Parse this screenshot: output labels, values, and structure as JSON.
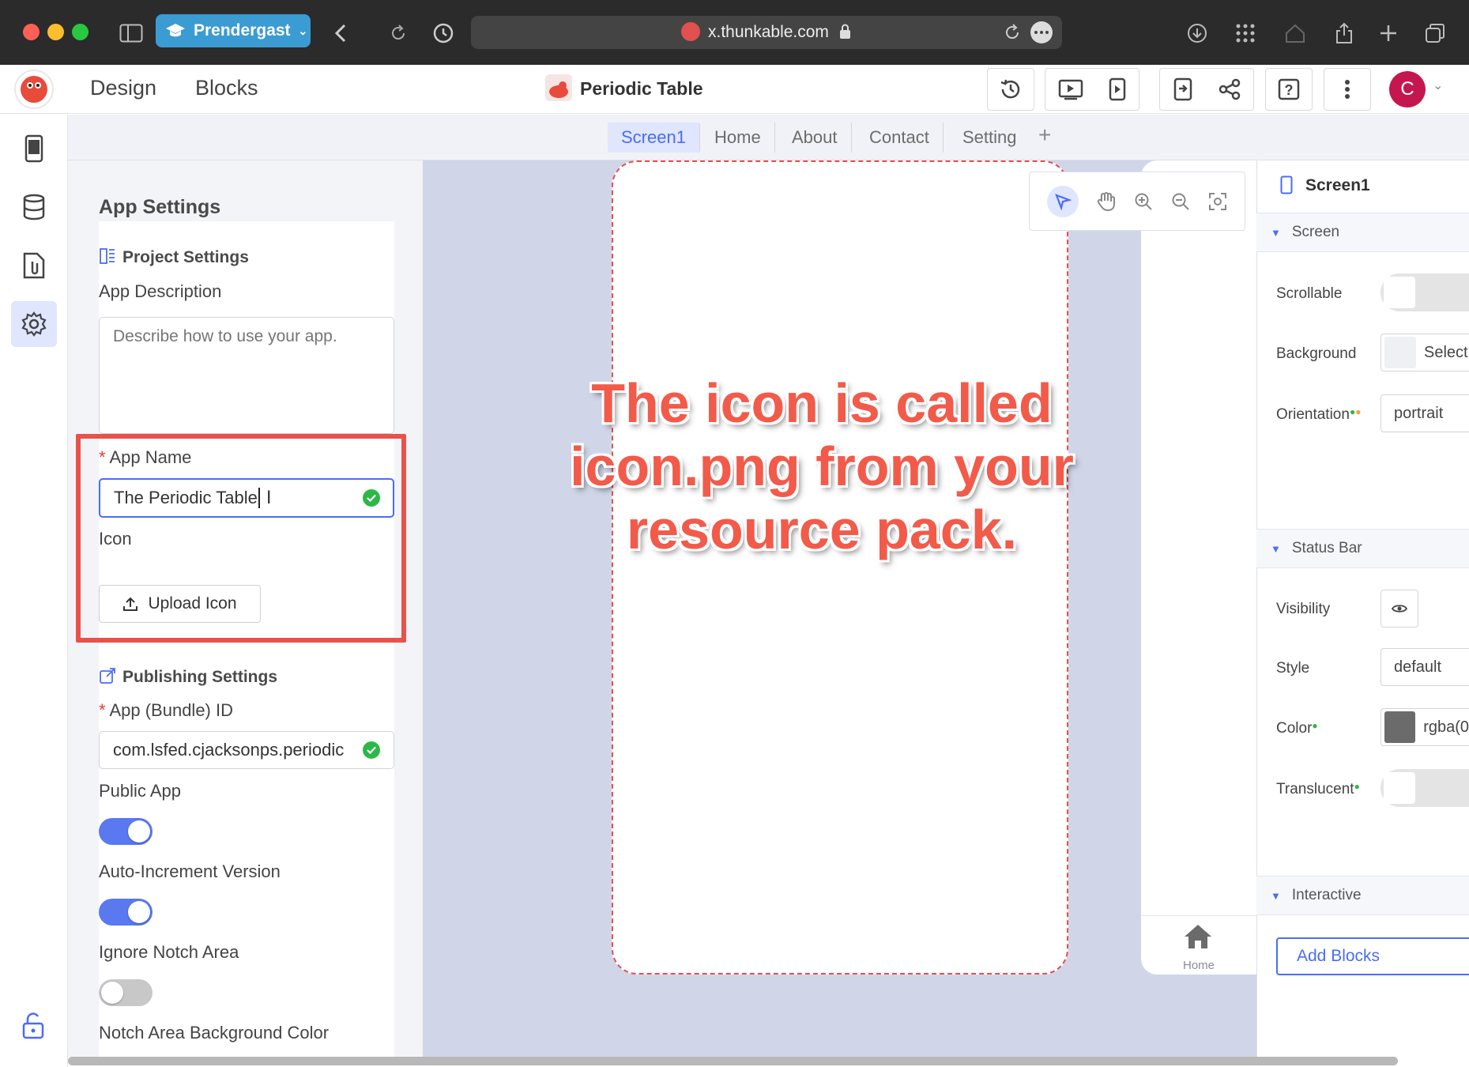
{
  "browser": {
    "profile_name": "Prendergast",
    "url": "x.thunkable.com"
  },
  "header": {
    "design_tab": "Design",
    "blocks_tab": "Blocks",
    "project_title": "Periodic Table",
    "avatar_letter": "C"
  },
  "screen_tabs": [
    "Screen1",
    "Home",
    "About",
    "Contact",
    "Setting"
  ],
  "settings": {
    "title": "App Settings",
    "project_settings": "Project Settings",
    "app_description_label": "App Description",
    "app_description_placeholder": "Describe how to use your app.",
    "app_name_required": "*",
    "app_name_label": "App Name",
    "app_name_value": "The Periodic Table",
    "icon_label": "Icon",
    "upload_icon_label": "Upload Icon",
    "publishing_settings": "Publishing Settings",
    "bundle_required": "*",
    "bundle_id_label": "App (Bundle) ID",
    "bundle_id_value": "com.lsfed.cjacksonps.periodic",
    "public_app_label": "Public App",
    "public_app_on": true,
    "auto_increment_label": "Auto-Increment Version",
    "auto_increment_on": true,
    "ignore_notch_label": "Ignore Notch Area",
    "ignore_notch_on": false,
    "notch_bg_label": "Notch Area Background Color"
  },
  "annotation": {
    "line1": "The icon is called",
    "line2": "icon.png from your",
    "line3": "resource pack."
  },
  "phone_tabbar": {
    "home_label": "Home"
  },
  "properties": {
    "component_name": "Screen1",
    "screen_section": "Screen",
    "scrollable_label": "Scrollable",
    "background_label": "Background",
    "background_value": "Select",
    "orientation_label": "Orientation",
    "orientation_value": "portrait",
    "status_bar_section": "Status Bar",
    "visibility_label": "Visibility",
    "style_label": "Style",
    "style_value": "default",
    "color_label": "Color",
    "color_value": "rgba(0",
    "translucent_label": "Translucent",
    "interactive_section": "Interactive",
    "add_blocks_label": "Add Blocks"
  },
  "colors": {
    "accent": "#4a6cf7",
    "highlight_box": "#e8524a",
    "annotation_text": "#f25a4a"
  }
}
